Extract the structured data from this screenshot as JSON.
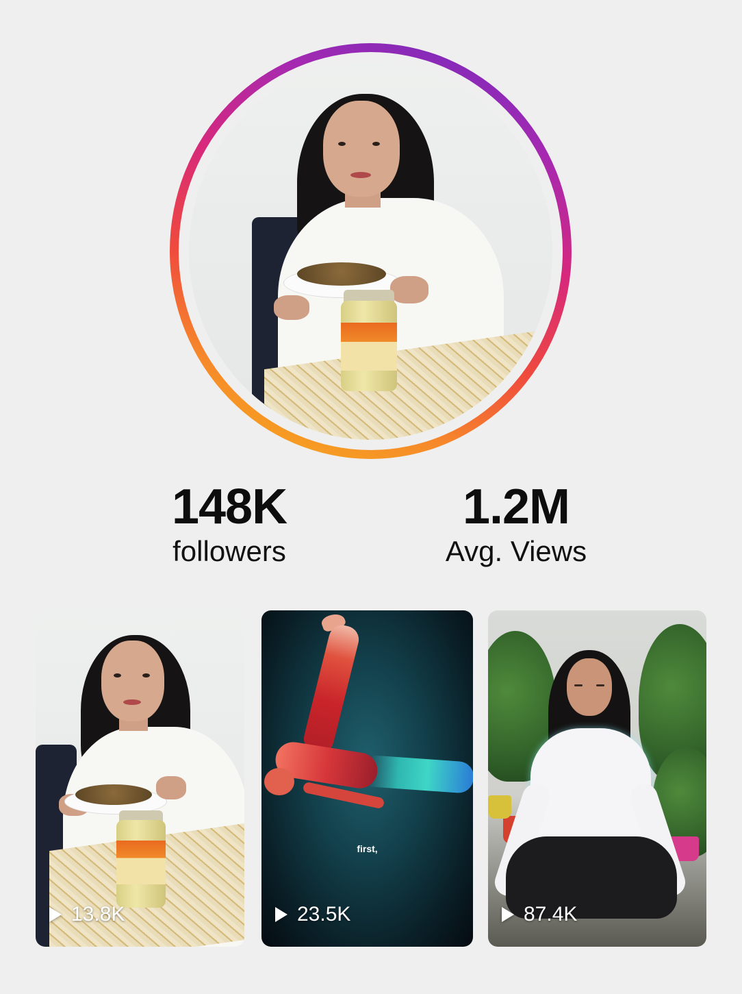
{
  "profile": {
    "followers_value": "148K",
    "followers_label": "followers",
    "views_value": "1.2M",
    "views_label": "Avg. Views",
    "ring_colors": [
      "#6a2cc0",
      "#d7287c",
      "#ef4a3d",
      "#f6b21a"
    ]
  },
  "videos": [
    {
      "views": "13.8K"
    },
    {
      "views": "23.5K",
      "caption": "first,"
    },
    {
      "views": "87.4K"
    }
  ],
  "icons": {
    "play": "play-icon"
  }
}
